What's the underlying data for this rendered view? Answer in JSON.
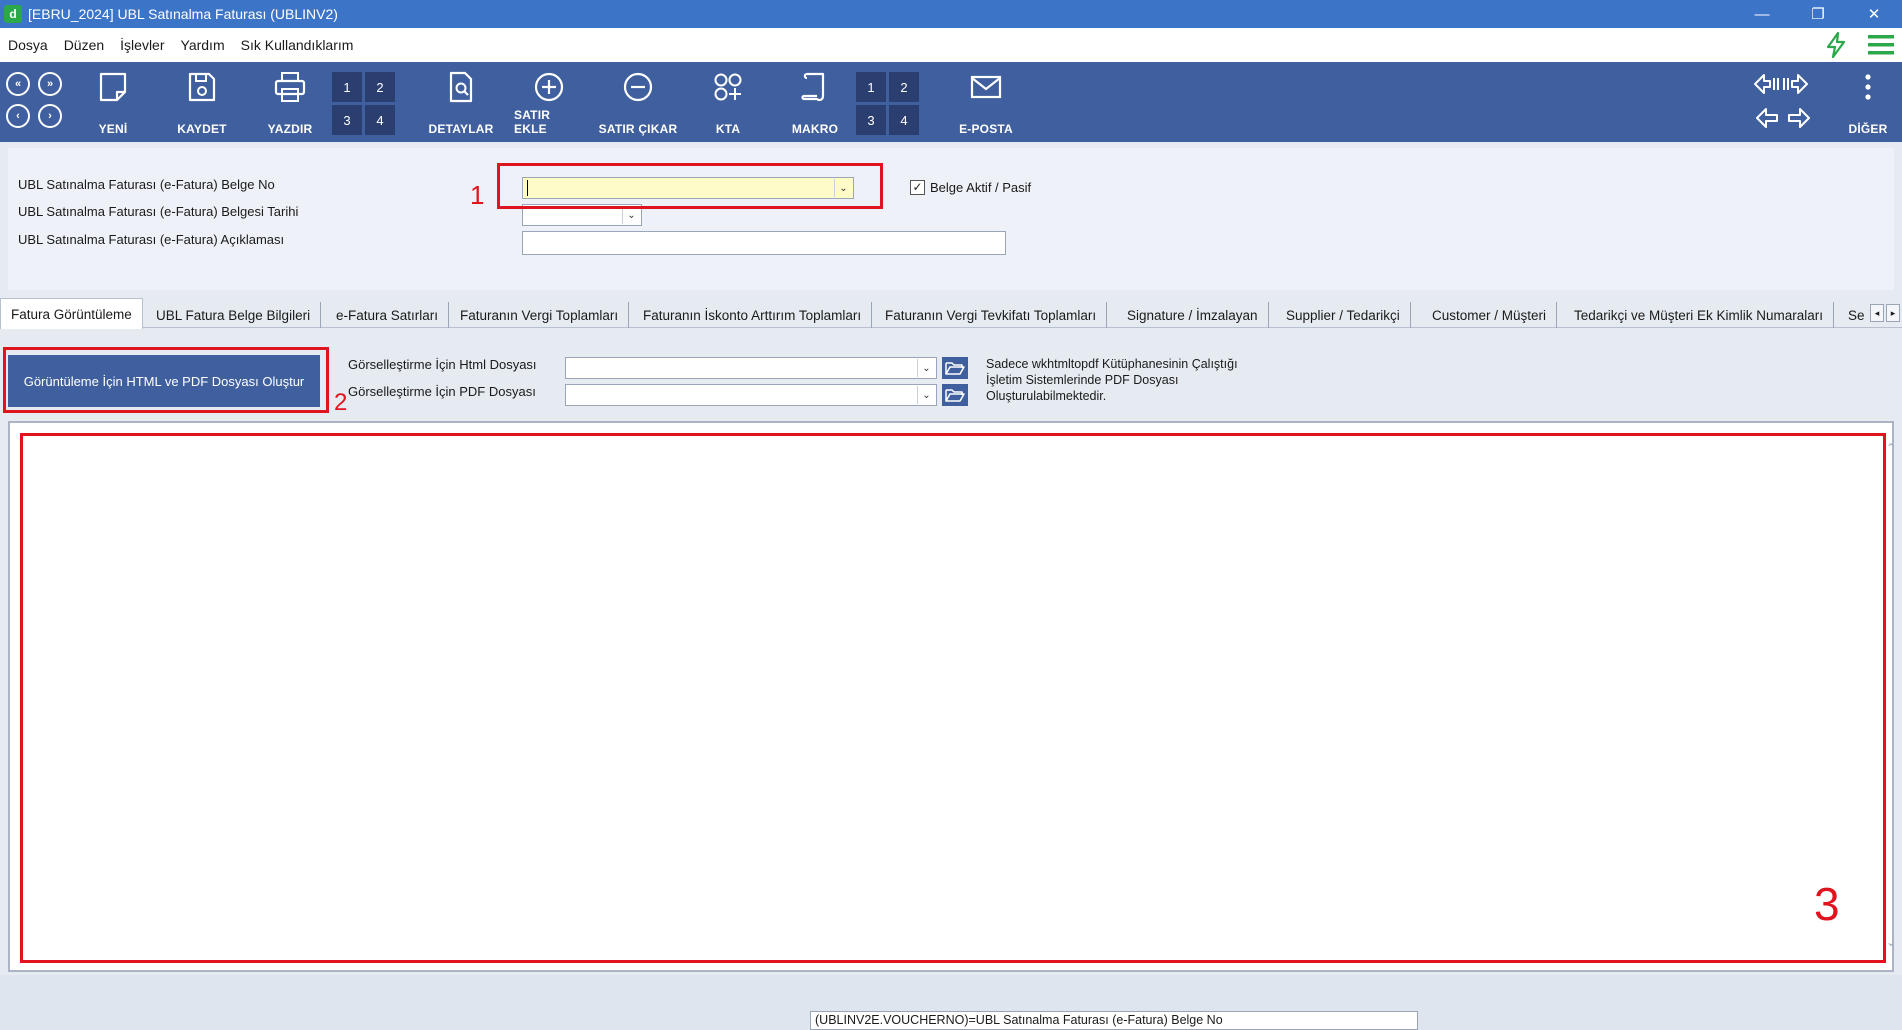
{
  "window": {
    "title": "[EBRU_2024] UBL Satınalma Faturası (UBLINV2)",
    "minimize": "—",
    "restore": "❐",
    "close": "✕"
  },
  "menu": {
    "items": [
      "Dosya",
      "Düzen",
      "İşlevler",
      "Yardım",
      "Sık Kullandıklarım"
    ]
  },
  "toolbar": {
    "nav": [
      "«",
      "»",
      "‹",
      "›"
    ],
    "buttons": {
      "yeni": "YENİ",
      "kaydet": "KAYDET",
      "yazdir": "YAZDIR",
      "detaylar": "DETAYLAR",
      "satir_ekle": "SATIR EKLE",
      "satir_cikar": "SATIR ÇIKAR",
      "kta": "KTA",
      "makro": "MAKRO",
      "eposta": "E-POSTA",
      "diger": "DİĞER"
    },
    "print_slots": [
      "1",
      "2",
      "3",
      "4"
    ],
    "macro_slots": [
      "1",
      "2",
      "3",
      "4"
    ]
  },
  "form": {
    "belge_no_label": "UBL Satınalma Faturası (e-Fatura) Belge No",
    "belge_no_value": "",
    "tarih_label": "UBL Satınalma Faturası (e-Fatura) Belgesi Tarihi",
    "tarih_value": "",
    "aciklama_label": "UBL Satınalma Faturası (e-Fatura) Açıklaması",
    "aciklama_value": "",
    "aktif_label": "Belge Aktif / Pasif",
    "aktif_checked": "✓"
  },
  "annotations": {
    "one": "1",
    "two": "2",
    "three": "3"
  },
  "tabs": [
    "Fatura Görüntüleme",
    "UBL Fatura Belge Bilgileri",
    "e-Fatura Satırları",
    "Faturanın Vergi Toplamları",
    "Faturanın İskonto Arttırım Toplamları",
    "Faturanın Vergi Tevkifatı Toplamları",
    "Signature / İmzalayan",
    "Supplier / Tedarikçi",
    "Customer / Müşteri",
    "Tedarikçi ve Müşteri Ek Kimlik Numaraları",
    "Se"
  ],
  "viewer_tab": {
    "generate_button": "Görüntüleme İçin HTML ve PDF Dosyası Oluştur",
    "html_label": "Görselleştirme İçin Html Dosyası",
    "html_value": "",
    "pdf_label": "Görselleştirme İçin PDF Dosyası",
    "pdf_value": "",
    "note_lines": [
      "Sadece wkhtmltopdf Kütüphanesinin Çalıştığı",
      "İşletim Sistemlerinde PDF Dosyası",
      "Oluşturulabilmektedir."
    ]
  },
  "status": {
    "field_text": "(UBLINV2E.VOUCHERNO)=UBL Satınalma Faturası (e-Fatura) Belge No"
  },
  "colors": {
    "titlebar": "#3c74c8",
    "toolbar": "#3f5f9e",
    "annotation_red": "#e0141e",
    "highlight_yellow": "#fffbc8"
  }
}
